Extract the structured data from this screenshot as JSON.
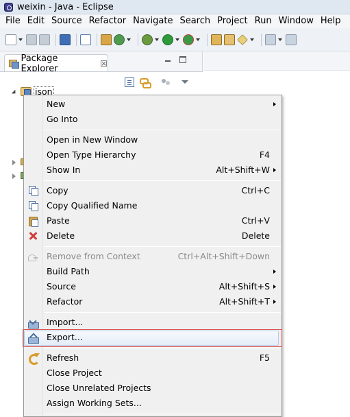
{
  "window": {
    "title": "weixin - Java - Eclipse"
  },
  "menubar": {
    "items": [
      "File",
      "Edit",
      "Source",
      "Refactor",
      "Navigate",
      "Search",
      "Project",
      "Run",
      "Window",
      "Help"
    ]
  },
  "toolbar": {
    "icons": [
      "new-wizard-icon",
      "save-icon",
      "save-all-icon",
      "print-icon",
      "toggle-breakpoint-icon",
      "new-package-icon",
      "new-class-icon",
      "debug-icon",
      "run-icon",
      "external-tools-icon",
      "open-type-icon",
      "open-task-icon",
      "search-icon",
      "next-annotation-icon",
      "back-icon"
    ]
  },
  "package_explorer": {
    "tab_label": "Package Explorer",
    "tab_close": "☒",
    "project_label": "json"
  },
  "context_menu": {
    "items": [
      {
        "label": "New",
        "shortcut": "",
        "submenu": true,
        "icon": "",
        "enabled": true
      },
      {
        "label": "Go Into",
        "shortcut": "",
        "submenu": false,
        "icon": "",
        "enabled": true
      },
      {
        "label": "Open in New Window",
        "shortcut": "",
        "submenu": false,
        "icon": "",
        "enabled": true
      },
      {
        "label": "Open Type Hierarchy",
        "shortcut": "F4",
        "submenu": false,
        "icon": "",
        "enabled": true
      },
      {
        "label": "Show In",
        "shortcut": "Alt+Shift+W",
        "submenu": true,
        "icon": "",
        "enabled": true
      },
      {
        "label": "Copy",
        "shortcut": "Ctrl+C",
        "submenu": false,
        "icon": "copy-icon",
        "enabled": true
      },
      {
        "label": "Copy Qualified Name",
        "shortcut": "",
        "submenu": false,
        "icon": "copy-qualified-name-icon",
        "enabled": true
      },
      {
        "label": "Paste",
        "shortcut": "Ctrl+V",
        "submenu": false,
        "icon": "paste-icon",
        "enabled": true
      },
      {
        "label": "Delete",
        "shortcut": "Delete",
        "submenu": false,
        "icon": "delete-icon",
        "enabled": true
      },
      {
        "label": "Remove from Context",
        "shortcut": "Ctrl+Alt+Shift+Down",
        "submenu": false,
        "icon": "remove-context-icon",
        "enabled": false
      },
      {
        "label": "Build Path",
        "shortcut": "",
        "submenu": true,
        "icon": "",
        "enabled": true
      },
      {
        "label": "Source",
        "shortcut": "Alt+Shift+S",
        "submenu": true,
        "icon": "",
        "enabled": true
      },
      {
        "label": "Refactor",
        "shortcut": "Alt+Shift+T",
        "submenu": true,
        "icon": "",
        "enabled": true
      },
      {
        "label": "Import...",
        "shortcut": "",
        "submenu": false,
        "icon": "import-icon",
        "enabled": true
      },
      {
        "label": "Export...",
        "shortcut": "",
        "submenu": false,
        "icon": "export-icon",
        "enabled": true,
        "hovered": true
      },
      {
        "label": "Refresh",
        "shortcut": "F5",
        "submenu": false,
        "icon": "refresh-icon",
        "enabled": true
      },
      {
        "label": "Close Project",
        "shortcut": "",
        "submenu": false,
        "icon": "",
        "enabled": true
      },
      {
        "label": "Close Unrelated Projects",
        "shortcut": "",
        "submenu": false,
        "icon": "",
        "enabled": true
      },
      {
        "label": "Assign Working Sets...",
        "shortcut": "",
        "submenu": false,
        "icon": "",
        "enabled": true
      }
    ]
  },
  "colors": {
    "highlight_border": "#d9534f",
    "hover_fill": "#e4edf8",
    "menu_background": "#f0f0f0"
  }
}
